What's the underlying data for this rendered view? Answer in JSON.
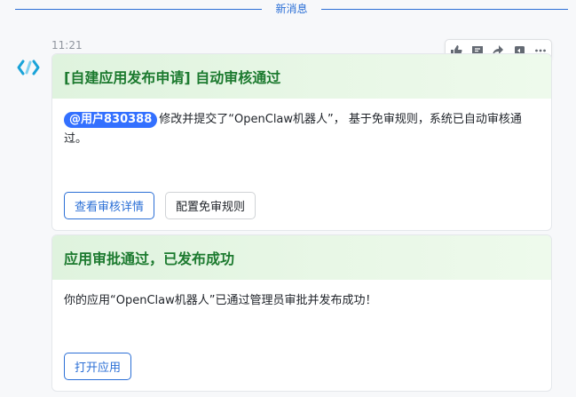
{
  "divider": {
    "label": "新消息"
  },
  "message": {
    "time": "11:21"
  },
  "toolbar": {
    "icons": [
      "thumbs-up-icon",
      "comment-icon",
      "forward-icon",
      "reply-icon",
      "more-icon"
    ]
  },
  "cards": [
    {
      "title": "[自建应用发布申请] 自动审核通过",
      "mention": "@用户830388",
      "text": "修改并提交了“OpenClaw机器人”， 基于免审规则，系统已自动审核通过。",
      "buttons": [
        "查看审核详情",
        "配置免审规则"
      ]
    },
    {
      "title": "应用审批通过，已发布成功",
      "text": "你的应用“OpenClaw机器人”已通过管理员审批并发布成功！",
      "buttons": [
        "打开应用"
      ]
    }
  ],
  "colors": {
    "accent": "#2b6fd6",
    "mention_bg": "#3370ff",
    "header_green": "#1c7a2f",
    "header_bg": "#dff3de"
  }
}
